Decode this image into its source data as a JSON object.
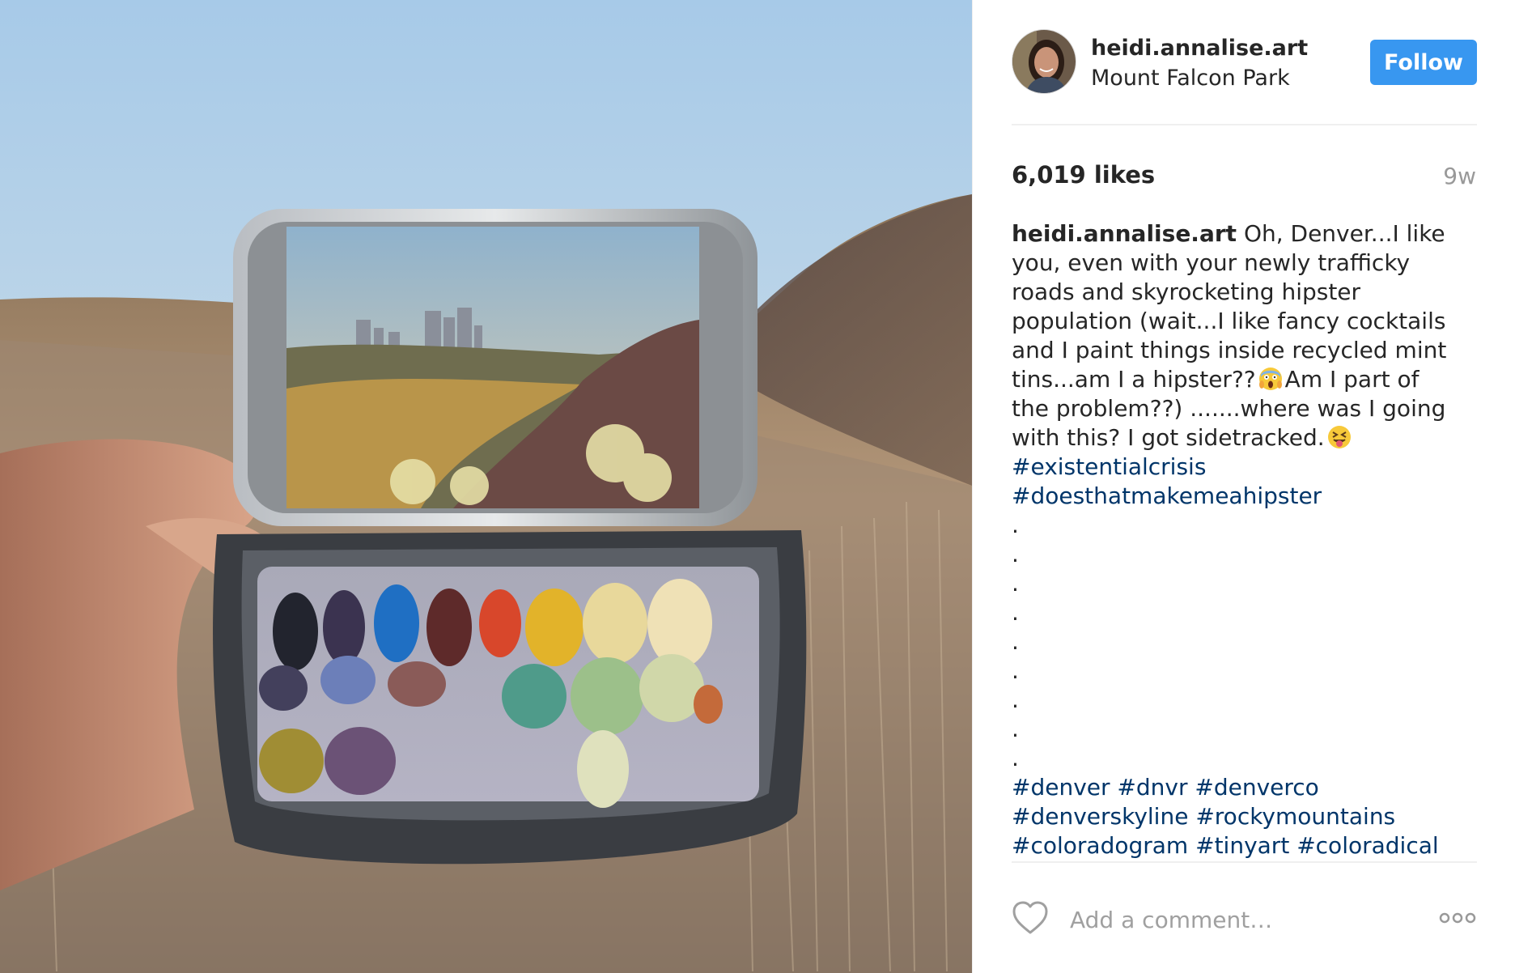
{
  "photo": {
    "alt_subject": "painting-in-mint-tin"
  },
  "post": {
    "username": "heidi.annalise.art",
    "location": "Mount Falcon Park",
    "follow_label": "Follow",
    "likes": "6,019 likes",
    "time_ago": "9w",
    "caption": {
      "username": "heidi.annalise.art",
      "line1": "Oh, Denver...I like",
      "line2": "you, even with your newly trafficky",
      "line3": "roads and skyrocketing hipster",
      "line4": "population (wait...I like fancy cocktails",
      "line5": "and I paint things inside recycled mint",
      "line6a": "tins...am I a hipster??",
      "line6b": "Am I part of",
      "line7": "the problem??) .......where was I going",
      "line8": "with this? I got sidetracked.",
      "tag_existential": "#existentialcrisis",
      "tag_hipster": "#doesthatmakemeahipster",
      "dots": [
        ".",
        ".",
        ".",
        ".",
        ".",
        ".",
        ".",
        ".",
        "."
      ],
      "tag_denver": "#denver",
      "tag_dnvr": "#dnvr",
      "tag_denverco": "#denverco",
      "tag_denverskyline": "#denverskyline",
      "tag_rockymountains": "#rockymountains",
      "tag_coloradogram": "#coloradogram",
      "tag_tinyart": "#tinyart",
      "tag_coloradical": "#coloradical",
      "emoji1": "scream-emoji",
      "emoji2": "tongue-wink-emoji"
    },
    "comment_placeholder": "Add a comment…",
    "heart_icon": "heart-outline-icon",
    "more_icon": "more-options-icon"
  },
  "colors": {
    "follow_bg": "#3897f0",
    "hashtag": "#003569",
    "muted": "#999999",
    "divider": "#efefef"
  }
}
